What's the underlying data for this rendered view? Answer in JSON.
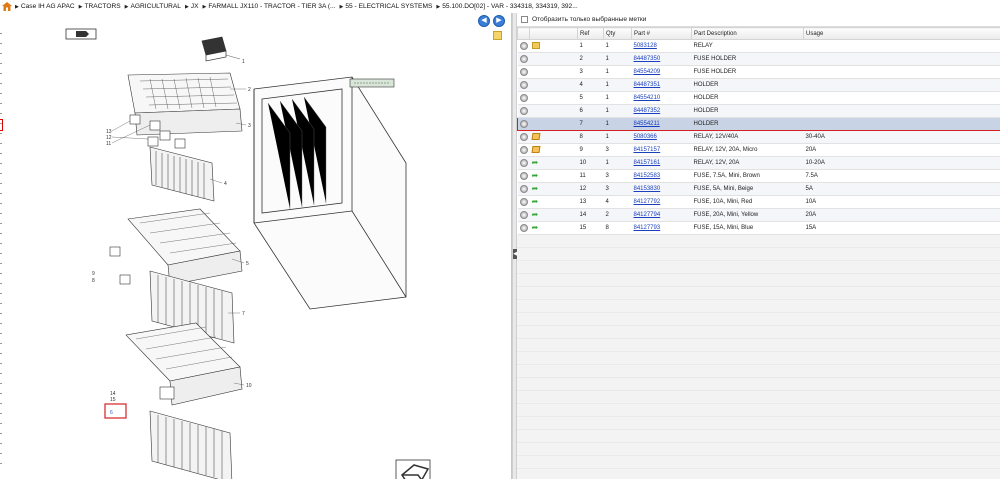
{
  "breadcrumb": [
    "Case IH AG APAC",
    "TRACTORS",
    "AGRICULTURAL",
    "JX",
    "FARMALL JX110 - TRACTOR - TIER 3A (...",
    "55 - ELECTRICAL SYSTEMS",
    "55.100.DO[02] - VAR - 334318, 334319, 392..."
  ],
  "filter": {
    "label": "Отобразить только выбранные метки",
    "checked": false
  },
  "columns": {
    "ref": "Ref",
    "qty": "Qty",
    "part": "Part #",
    "desc": "Part Description",
    "usage": "Usage"
  },
  "rows": [
    {
      "ref": "1",
      "qty": "1",
      "part": "5083128",
      "desc": "RELAY",
      "usage": "",
      "status": "folder"
    },
    {
      "ref": "2",
      "qty": "1",
      "part": "84487350",
      "desc": "FUSE HOLDER",
      "usage": "",
      "status": ""
    },
    {
      "ref": "3",
      "qty": "1",
      "part": "84554209",
      "desc": "FUSE HOLDER",
      "usage": "",
      "status": ""
    },
    {
      "ref": "4",
      "qty": "1",
      "part": "84487351",
      "desc": "HOLDER",
      "usage": "",
      "status": ""
    },
    {
      "ref": "5",
      "qty": "1",
      "part": "84554210",
      "desc": "HOLDER",
      "usage": "",
      "status": ""
    },
    {
      "ref": "6",
      "qty": "1",
      "part": "84487352",
      "desc": "HOLDER",
      "usage": "",
      "status": ""
    },
    {
      "ref": "7",
      "qty": "1",
      "part": "84554211",
      "desc": "HOLDER",
      "usage": "",
      "status": "",
      "selected": true
    },
    {
      "ref": "8",
      "qty": "1",
      "part": "5080366",
      "desc": "RELAY, 12V/40A",
      "usage": "30-40A",
      "status": "box"
    },
    {
      "ref": "9",
      "qty": "3",
      "part": "84157157",
      "desc": "RELAY, 12V, 20A, Micro",
      "usage": "20A",
      "status": "box"
    },
    {
      "ref": "10",
      "qty": "1",
      "part": "84157161",
      "desc": "RELAY, 12V, 20A",
      "usage": "10-20A",
      "status": "arrow"
    },
    {
      "ref": "11",
      "qty": "3",
      "part": "84152583",
      "desc": "FUSE, 7.5A, Mini, Brown",
      "usage": "7.5A",
      "status": "arrow"
    },
    {
      "ref": "12",
      "qty": "3",
      "part": "84153830",
      "desc": "FUSE, 5A, Mini, Beige",
      "usage": "5A",
      "status": "arrow"
    },
    {
      "ref": "13",
      "qty": "4",
      "part": "84127792",
      "desc": "FUSE, 10A, Mini, Red",
      "usage": "10A",
      "status": "arrow"
    },
    {
      "ref": "14",
      "qty": "2",
      "part": "84127794",
      "desc": "FUSE, 20A, Mini, Yellow",
      "usage": "20A",
      "status": "arrow"
    },
    {
      "ref": "15",
      "qty": "8",
      "part": "84127793",
      "desc": "FUSE, 15A, Mini, Blue",
      "usage": "15A",
      "status": "arrow"
    }
  ],
  "diagram": {
    "callouts": [
      "1",
      "2",
      "3",
      "4",
      "5",
      "6",
      "7",
      "8",
      "9",
      "10",
      "11",
      "12",
      "13",
      "14",
      "15"
    ]
  },
  "colors": {
    "selection_border": "#d42020",
    "link": "#1a3fbf",
    "accent": "#3b7ed8"
  }
}
